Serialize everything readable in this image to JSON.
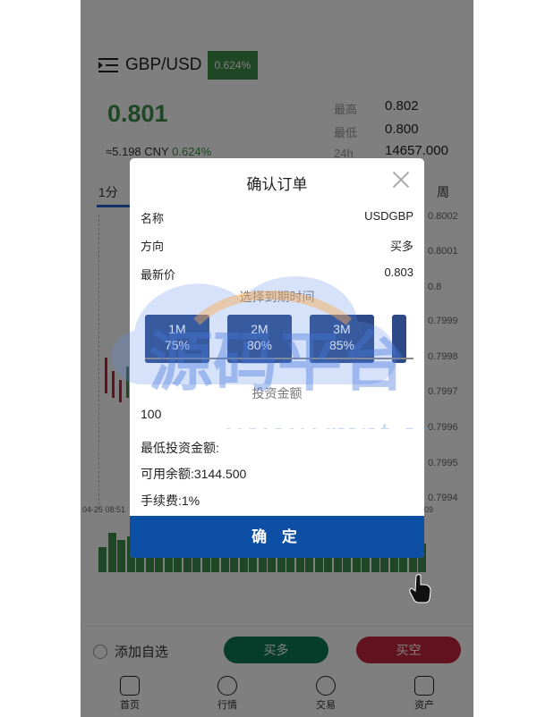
{
  "header": {
    "pair": "GBP/USD",
    "change_badge": "0.624%"
  },
  "quote": {
    "price": "0.801",
    "cny": "≈5.198 CNY",
    "cny_change": "0.624%",
    "stats": [
      {
        "label": "最高",
        "value": "0.802"
      },
      {
        "label": "最低",
        "value": "0.800"
      },
      {
        "label": "24h",
        "value": "14657.000"
      }
    ]
  },
  "period_tabs": {
    "active": "1分",
    "last": "周"
  },
  "chart_axis": {
    "y_ticks": [
      "0.8002",
      "0.8001",
      "0.8",
      "0.7999",
      "0.7998",
      "0.7997",
      "0.7996",
      "0.7995",
      "0.7994"
    ],
    "x_ticks": [
      "04-25 08:51",
      "09"
    ]
  },
  "bottom_bar": {
    "favorite": "添加自选",
    "buy_long": "买多",
    "buy_short": "买空",
    "nav": [
      "首页",
      "行情",
      "交易",
      "资产"
    ]
  },
  "modal": {
    "title": "确认订单",
    "rows": [
      {
        "label": "名称",
        "value": "USDGBP"
      },
      {
        "label": "方向",
        "value": "买多"
      },
      {
        "label": "最新价",
        "value": "0.803"
      }
    ],
    "expiry_title": "选择到期时间",
    "options": [
      {
        "duration": "1M",
        "rate": "75%"
      },
      {
        "duration": "2M",
        "rate": "80%"
      },
      {
        "duration": "3M",
        "rate": "85%"
      }
    ],
    "amount_title": "投资金额",
    "amount_value": "100",
    "min_invest": "最低投资金额:",
    "available": "可用余额:3144.500",
    "fee": "手续费:1%",
    "confirm": "确 定"
  },
  "watermark": {
    "brand": "源码平台",
    "url": "www.ympt.cc"
  },
  "colors": {
    "up": "#3e8e4a",
    "down": "#c7263e",
    "primary": "#0e4fa6",
    "option": "#2d4a86"
  }
}
